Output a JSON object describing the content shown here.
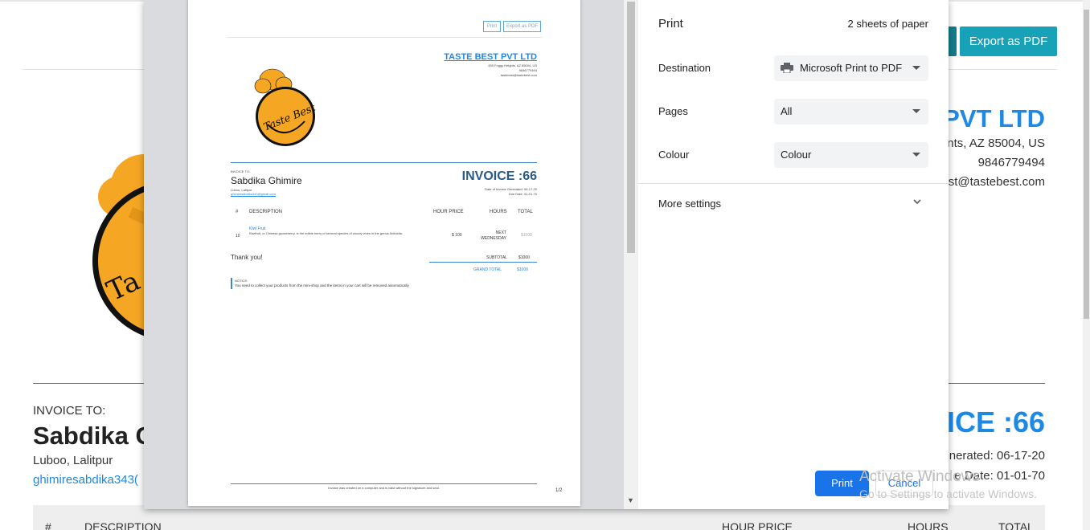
{
  "background": {
    "toolbar": {
      "export_pdf_label": "Export as PDF"
    },
    "company": {
      "name": "PVT LTD",
      "address": "nts, AZ 85004, US",
      "phone": "9846779494",
      "email": "st@tastebest.com"
    },
    "invoice_to_label": "INVOICE TO:",
    "client_name": "Sabdika G",
    "client_address": "Luboo, Lalitpur",
    "client_email": "ghimiresabdika343(",
    "invoice_number": "ICE :66",
    "date_generated": "nerated: 06-17-20",
    "due_date": "e Date: 01-01-70",
    "table_headers": [
      "#",
      "DESCRIPTION",
      "HOUR PRICE",
      "HOURS",
      "TOTAL"
    ],
    "watermark": {
      "line1": "Activate Windows",
      "line2": "Go to Settings to activate Windows."
    }
  },
  "preview": {
    "print_label": "Print",
    "export_label": "Export as PDF",
    "company_name": "TASTE BEST PVT LTD",
    "company_lines": [
      "455 Foggy Heights, AZ 85004, US",
      "9846779494",
      "tastebest@tastebest.com"
    ],
    "invoice_to_label": "INVOICE TO:",
    "client_name": "Sabdika Ghimire",
    "client_address": "Luboo, Lalitpur",
    "client_email": "ghimiresabdika343@gmail.com",
    "invoice_number": "INVOICE :66",
    "date_generated": "Date of Invoice Generated: 06-17-20",
    "due_date": "Due Date: 01-01-70",
    "table_headers": {
      "num": "#",
      "desc": "DESCRIPTION",
      "price": "HOUR PRICE",
      "hours": "HOURS",
      "total": "TOTAL"
    },
    "item": {
      "num": "10",
      "name": "Kiwi Fruit",
      "desc": "Kiwifruit, or Chinese gooseberry, is the edible berry of several species of woody vines in the genus Actinidia.",
      "price": "$ 100",
      "hours": "NEXT WEDNESDAY",
      "total": "$1000"
    },
    "thanks": "Thank you!",
    "subtotal_label": "SUBTOTAL",
    "subtotal_value": "$1000",
    "grand_total_label": "GRAND TOTAL",
    "grand_total_value": "$1000",
    "notice_label": "NOTICE:",
    "notice_text": "You need to collect your products from the mini-shop and the items in your cart will be removed automatically",
    "footer": "Invoice was created on a computer and is valid without the signature and seal.",
    "page_number": "1/2"
  },
  "print_panel": {
    "title": "Print",
    "sheets": "2 sheets of paper",
    "destination_label": "Destination",
    "destination_value": "Microsoft Print to PDF",
    "pages_label": "Pages",
    "pages_value": "All",
    "colour_label": "Colour",
    "colour_value": "Colour",
    "more_settings": "More settings",
    "print_button": "Print",
    "cancel_button": "Cancel"
  },
  "colors": {
    "accent": "#1a73e8",
    "brand_blue": "#1e88e5",
    "teal": "#17a2b8",
    "logo_orange": "#f5a623"
  },
  "icons": {
    "printer": "printer-icon",
    "chevron": "chevron-down-icon",
    "logo": "chef-hat-logo"
  }
}
